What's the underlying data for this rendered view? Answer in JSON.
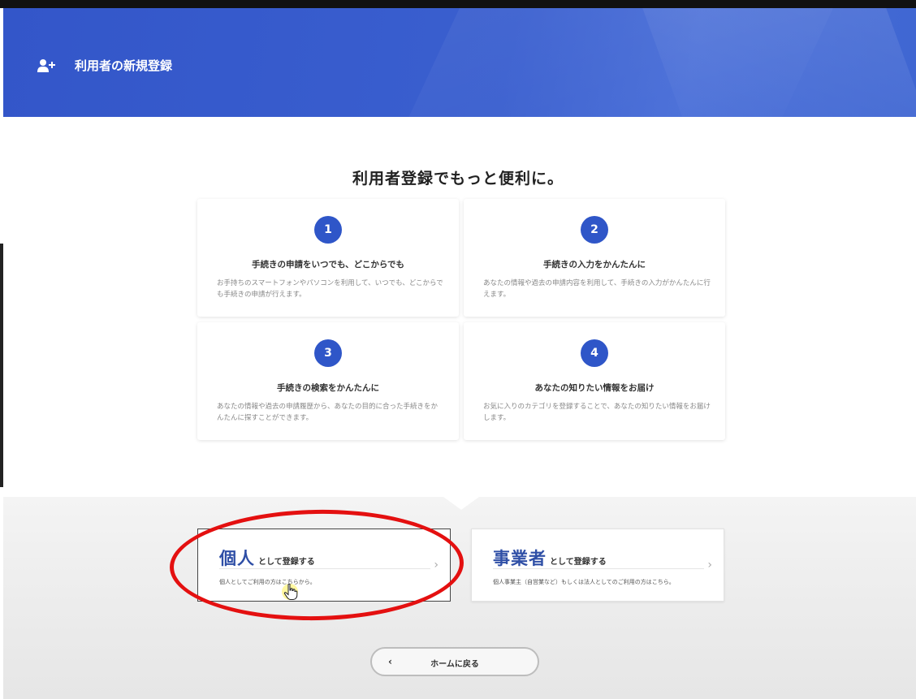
{
  "header": {
    "icon": "user-add-icon",
    "title": "利用者の新規登録",
    "color": "#3356c9"
  },
  "main": {
    "headline": "利用者登録でもっと便利に。",
    "features": [
      {
        "number": "1",
        "title": "手続きの申請をいつでも、どこからでも",
        "description": "お手持ちのスマートフォンやパソコンを利用して、いつでも、どこからでも手続きの申請が行えます。"
      },
      {
        "number": "2",
        "title": "手続きの入力をかんたんに",
        "description": "あなたの情報や過去の申請内容を利用して、手続きの入力がかんたんに行えます。"
      },
      {
        "number": "3",
        "title": "手続きの検索をかんたんに",
        "description": "あなたの情報や過去の申請履歴から、あなたの目的に合った手続きをかんたんに探すことができます。"
      },
      {
        "number": "4",
        "title": "あなたの知りたい情報をお届け",
        "description": "お気に入りのカテゴリを登録することで、あなたの知りたい情報をお届けします。"
      }
    ]
  },
  "registration": {
    "personal": {
      "big_label": "個人",
      "small_label": "として登録する",
      "description": "個人としてご利用の方はこちらから。",
      "icon": "chevron-right-icon"
    },
    "business": {
      "big_label": "事業者",
      "small_label": "として登録する",
      "description": "個人事業主（自営業など）もしくは法人としてのご利用の方はこちら。",
      "icon": "chevron-right-icon"
    }
  },
  "footer": {
    "home_button_label": "ホームに戻る",
    "home_button_icon": "chevron-left-icon"
  },
  "colors": {
    "accent": "#2f56c8",
    "annotation": "#e41010"
  }
}
